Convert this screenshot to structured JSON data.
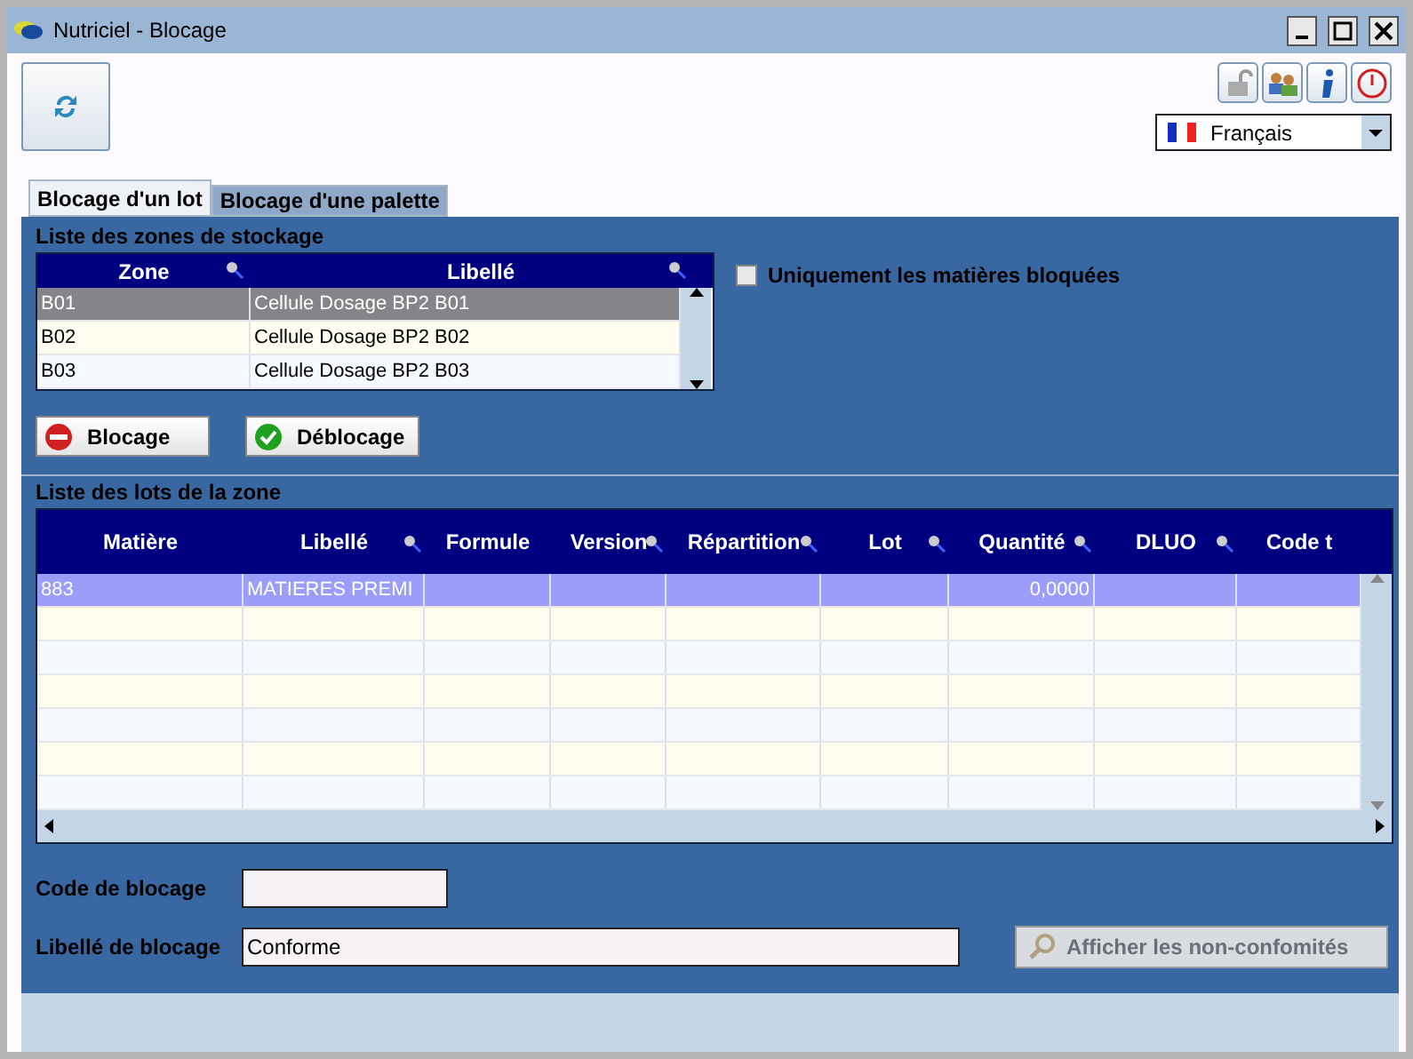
{
  "window": {
    "title": "Nutriciel - Blocage"
  },
  "language": {
    "value": "Français"
  },
  "tabs": [
    {
      "label": "Blocage d'un lot",
      "selected": true
    },
    {
      "label": "Blocage d'une palette",
      "selected": false
    }
  ],
  "zones": {
    "title": "Liste des zones de stockage",
    "columns": [
      "Zone",
      "Libellé"
    ],
    "rows": [
      {
        "cells": [
          "B01",
          "Cellule Dosage BP2 B01"
        ],
        "selected": true
      },
      {
        "cells": [
          "B02",
          "Cellule Dosage BP2 B02"
        ],
        "selected": false
      },
      {
        "cells": [
          "B03",
          "Cellule Dosage BP2 B03"
        ],
        "selected": false
      }
    ]
  },
  "only_blocked": {
    "label": "Uniquement les matières bloquées",
    "checked": false
  },
  "buttons": [
    {
      "kind": "block",
      "label": "Blocage"
    },
    {
      "kind": "unblock",
      "label": "Déblocage"
    }
  ],
  "lots": {
    "title": "Liste des lots de la zone",
    "columns": [
      "Matière",
      "Libellé",
      "Formule",
      "Version",
      "Répartition",
      "Lot",
      "Quantité",
      "DLUO",
      "Code t"
    ],
    "rows": [
      {
        "cells": [
          "883",
          "MATIERES PREMI",
          null,
          null,
          null,
          null,
          "0,0000",
          null,
          null
        ],
        "selected": true
      }
    ]
  },
  "form": {
    "code_label": "Code de blocage",
    "libelle_label": "Libellé de blocage",
    "libelle_value": "Conforme"
  },
  "nc_button": {
    "label": "Afficher les non-confomités",
    "disabled": true
  }
}
